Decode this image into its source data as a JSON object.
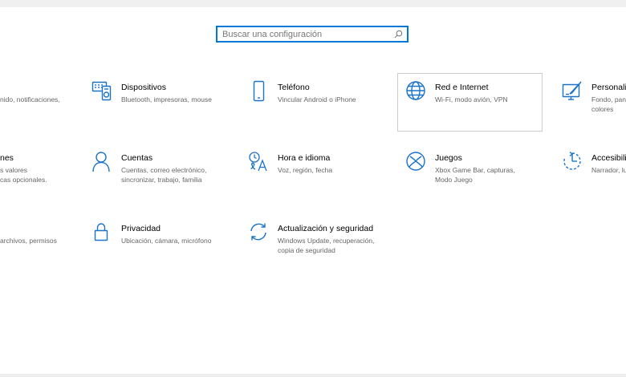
{
  "search": {
    "placeholder": "Buscar una configuración"
  },
  "tiles": {
    "sistema": {
      "desc": "nido, notificaciones,"
    },
    "dispositivos": {
      "title": "Dispositivos",
      "desc": "Bluetooth, impresoras, mouse"
    },
    "telefono": {
      "title": "Teléfono",
      "desc": "Vincular Android o iPhone"
    },
    "red": {
      "title": "Red e Internet",
      "desc": "Wi-Fi, modo avión, VPN"
    },
    "personalizacion": {
      "title": "Personaliz",
      "desc1": "Fondo, pant",
      "desc2": "colores"
    },
    "aplicaciones": {
      "title": "nes",
      "desc1": "s valores",
      "desc2": "cas opcionales."
    },
    "cuentas": {
      "title": "Cuentas",
      "desc1": "Cuentas, correo electrónico,",
      "desc2": "sincronizar, trabajo, familia"
    },
    "hora": {
      "title": "Hora e idioma",
      "desc": "Voz, región, fecha"
    },
    "juegos": {
      "title": "Juegos",
      "desc1": "Xbox Game Bar, capturas,",
      "desc2": "Modo Juego"
    },
    "accesibilidad": {
      "title": "Accesibili",
      "desc": "Narrador, lu"
    },
    "busqueda": {
      "desc": "archivos, permisos"
    },
    "privacidad": {
      "title": "Privacidad",
      "desc": "Ubicación, cámara, micrófono"
    },
    "actualizacion": {
      "title": "Actualización y seguridad",
      "desc1": "Windows Update, recuperación,",
      "desc2": "copia de seguridad"
    }
  },
  "colors": {
    "accent": "#0078d7",
    "icon": "#1a73c9"
  }
}
